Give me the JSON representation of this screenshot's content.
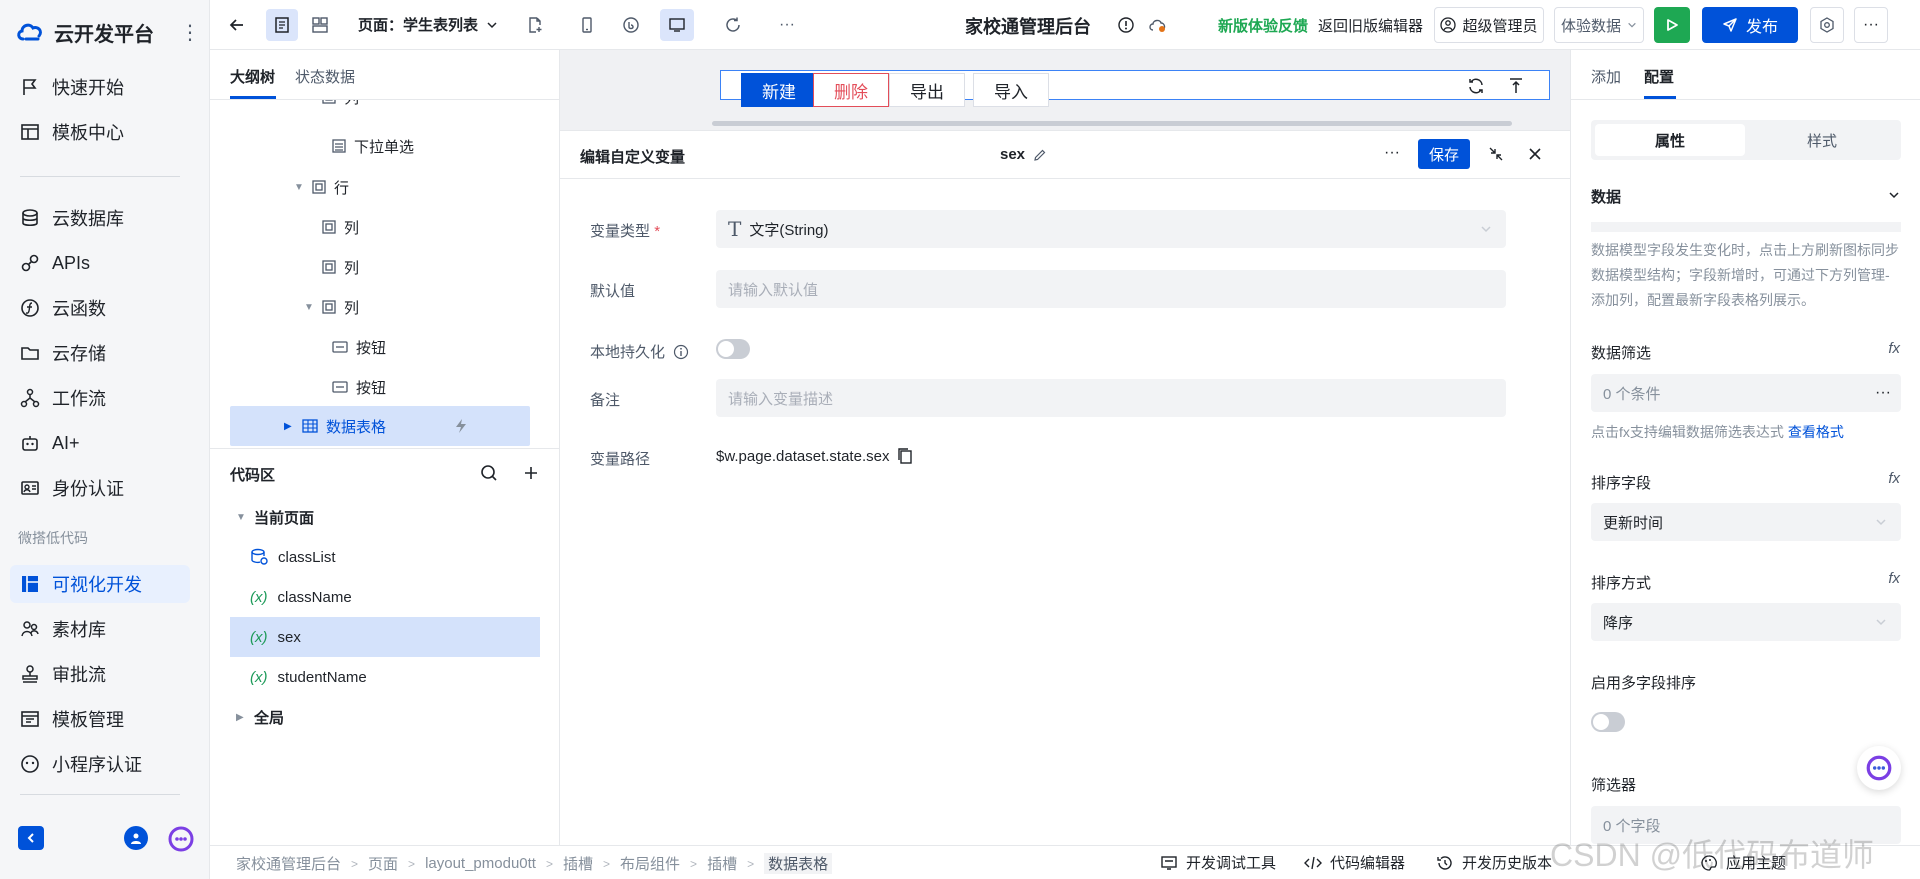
{
  "leftnav": {
    "brand": "云开发平台",
    "items_top": [
      {
        "label": "快速开始",
        "icon": "flag-icon"
      },
      {
        "label": "模板中心",
        "icon": "template-icon"
      }
    ],
    "items_mid": [
      {
        "label": "云数据库",
        "icon": "database-icon"
      },
      {
        "label": "APIs",
        "icon": "link-icon"
      },
      {
        "label": "云函数",
        "icon": "function-icon"
      },
      {
        "label": "云存储",
        "icon": "folder-icon"
      },
      {
        "label": "工作流",
        "icon": "workflow-icon"
      },
      {
        "label": "AI+",
        "icon": "robot-icon"
      },
      {
        "label": "身份认证",
        "icon": "id-card-icon"
      }
    ],
    "group_label": "微搭低代码",
    "items_low": [
      {
        "label": "可视化开发",
        "icon": "layout-icon",
        "active": true
      },
      {
        "label": "素材库",
        "icon": "material-icon"
      },
      {
        "label": "审批流",
        "icon": "stamp-icon"
      },
      {
        "label": "模板管理",
        "icon": "template-manage-icon"
      },
      {
        "label": "小程序认证",
        "icon": "miniapp-icon"
      }
    ]
  },
  "topbar": {
    "page_label": "页面：学生表列表",
    "app_title": "家校通管理后台",
    "feedback": "新版体验反馈",
    "old_editor": "返回旧版编辑器",
    "user": "超级管理员",
    "exp_data": "体验数据",
    "publish": "发布"
  },
  "outline": {
    "tabs": [
      "大纲树",
      "状态数据"
    ],
    "tree": [
      {
        "label": "列",
        "icon": "column-icon",
        "indent": 70
      },
      {
        "label": "下拉单选",
        "icon": "select-icon",
        "indent": 80
      },
      {
        "label": "行",
        "icon": "row-icon",
        "indent": 52,
        "caret": "▼"
      },
      {
        "label": "列",
        "icon": "column-icon",
        "indent": 70
      },
      {
        "label": "列",
        "icon": "column-icon",
        "indent": 70
      },
      {
        "label": "列",
        "icon": "column-icon",
        "indent": 60,
        "caret": "▼"
      },
      {
        "label": "按钮",
        "icon": "button-icon",
        "indent": 80
      },
      {
        "label": "按钮",
        "icon": "button-icon",
        "indent": 80
      },
      {
        "label": "数据表格",
        "icon": "table-icon",
        "indent": 42,
        "caret": "▶",
        "selected": true
      }
    ],
    "code_area": "代码区",
    "current_page": "当前页面",
    "vars": [
      {
        "label": "classList",
        "type": "datasource"
      },
      {
        "label": "className",
        "type": "var"
      },
      {
        "label": "sex",
        "type": "var",
        "selected": true
      },
      {
        "label": "studentName",
        "type": "var"
      }
    ],
    "global": "全局"
  },
  "canvas": {
    "buttons": [
      "新建",
      "删除",
      "导出",
      "导入"
    ]
  },
  "editor": {
    "title": "编辑自定义变量",
    "var_name": "sex",
    "save": "保存",
    "fields": {
      "type_label": "变量类型",
      "type_value": "文字(String)",
      "default_label": "默认值",
      "default_placeholder": "请输入默认值",
      "persist_label": "本地持久化",
      "note_label": "备注",
      "note_placeholder": "请输入变量描述",
      "path_label": "变量路径",
      "path_value": "$w.page.dataset.state.sex"
    }
  },
  "rightpanel": {
    "tabs": [
      "添加",
      "配置"
    ],
    "seg": [
      "属性",
      "样式"
    ],
    "data_section": "数据",
    "data_hint": "数据模型字段发生变化时，点击上方刷新图标同步数据模型结构；字段新增时，可通过下方列管理-添加列，配置最新字段表格列展示。",
    "filter_label": "数据筛选",
    "filter_value": "0 个条件",
    "filter_hint": "点击fx支持编辑数据筛选表达式",
    "filter_link": "查看格式",
    "sort_field_label": "排序字段",
    "sort_field_value": "更新时间",
    "sort_order_label": "排序方式",
    "sort_order_value": "降序",
    "multi_sort_label": "启用多字段排序",
    "filter2_label": "筛选器",
    "filter2_value": "0 个字段",
    "fx": "fx"
  },
  "bottombar": {
    "crumbs": [
      "家校通管理后台",
      "页面",
      "layout_pmodu0tt",
      "插槽",
      "布局组件",
      "插槽",
      "数据表格"
    ],
    "tools": [
      "开发调试工具",
      "代码编辑器",
      "开发历史版本",
      "应用主题"
    ]
  },
  "watermark": "CSDN @低代码布道师",
  "colors": {
    "accent": "#0052d9",
    "green": "#1ea853",
    "danger": "#e34d59"
  }
}
